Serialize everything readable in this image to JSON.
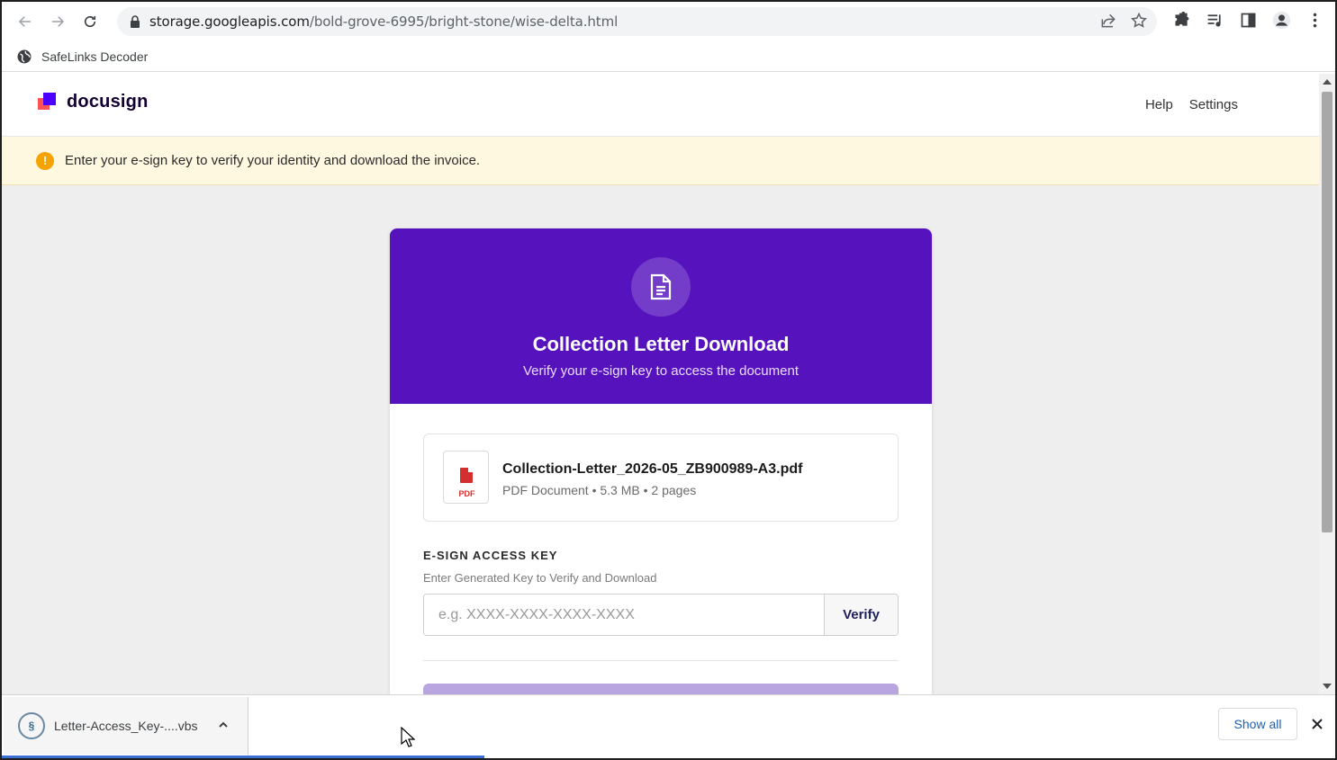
{
  "browser": {
    "url_host": "storage.googleapis.com",
    "url_path": "/bold-grove-6995/bright-stone/wise-delta.html",
    "bookmark": "SafeLinks Decoder"
  },
  "header": {
    "logo": "docusign",
    "nav": [
      "Help",
      "Settings"
    ]
  },
  "alert": {
    "icon": "!",
    "text": "Enter your e-sign key to verify your identity and download the invoice."
  },
  "card": {
    "title": "Collection Letter Download",
    "subtitle": "Verify your e-sign key to access the document",
    "file": {
      "badge": "PDF",
      "name": "Collection-Letter_2026-05_ZB900989-A3.pdf",
      "meta": "PDF Document • 5.3 MB • 2 pages"
    },
    "key": {
      "label": "E-SIGN ACCESS KEY",
      "hint": "Enter Generated Key to Verify and Download",
      "placeholder": "e.g. XXXX-XXXX-XXXX-XXXX",
      "verify": "Verify"
    }
  },
  "downloads": {
    "file": "Letter-Access_Key-....vbs",
    "show_all": "Show all"
  },
  "colors": {
    "hero": "#5512bd",
    "alert_bg": "#fff8e1",
    "brand_red": "#ff5252",
    "brand_purple": "#4c00ff"
  }
}
